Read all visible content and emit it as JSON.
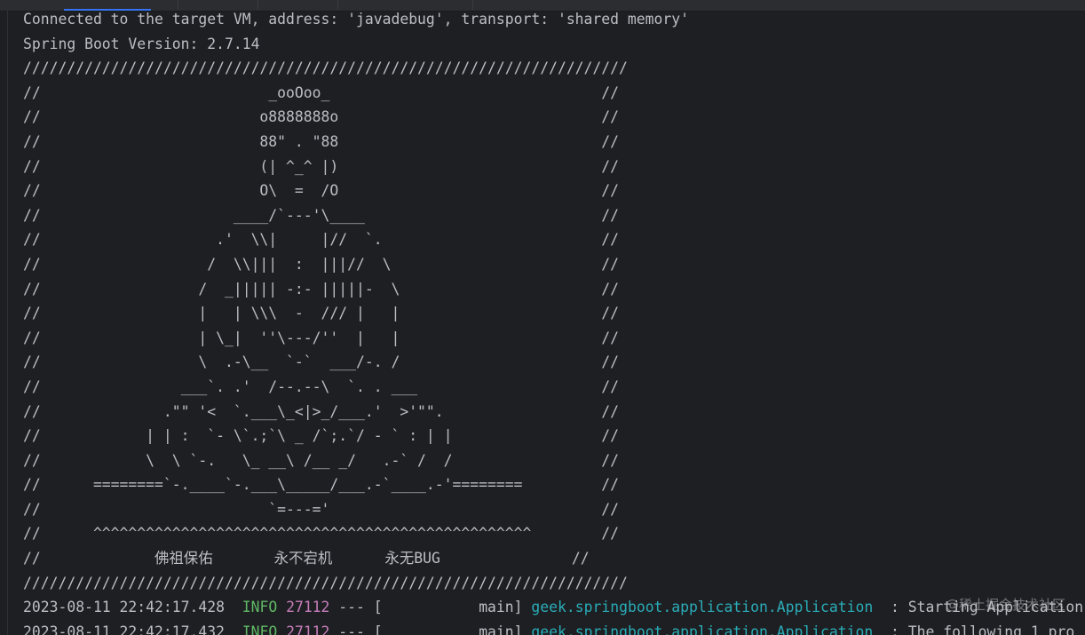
{
  "console": {
    "header_lines": [
      "Connected to the target VM, address: 'javadebug', transport: 'shared memory'",
      "Spring Boot Version: 2.7.14"
    ],
    "banner_lines": [
      "/////////////////////////////////////////////////////////////////////",
      "//                          _ooOoo_                               //",
      "//                         o8888888o                              //",
      "//                         88\" . \"88                              //",
      "//                         (| ^_^ |)                              //",
      "//                         O\\  =  /O                              //",
      "//                      ____/`---'\\____                           //",
      "//                    .'  \\\\|     |//  `.                         //",
      "//                   /  \\\\|||  :  |||//  \\                        //",
      "//                  /  _||||| -:- |||||-  \\                       //",
      "//                  |   | \\\\\\  -  /// |   |                       //",
      "//                  | \\_|  ''\\---/''  |   |                       //",
      "//                  \\  .-\\__  `-`  ___/-. /                       //",
      "//                ___`. .'  /--.--\\  `. . ___                     //",
      "//              .\"\" '<  `.___\\_<|>_/___.'  >'\"\".                  //",
      "//            | | :  `- \\`.;`\\ _ /`;.`/ - ` : | |                 //",
      "//            \\  \\ `-.   \\_ __\\ /__ _/   .-` /  /                 //",
      "//      ========`-.____`-.___\\_____/___.-`____.-'========         //",
      "//                          `=---='                               //",
      "//      ^^^^^^^^^^^^^^^^^^^^^^^^^^^^^^^^^^^^^^^^^^^^^^^^^^        //",
      "//             佛祖保佑       永不宕机      永无BUG               //",
      "/////////////////////////////////////////////////////////////////////"
    ],
    "log_lines": [
      {
        "timestamp": "2023-08-11 22:42:17.428",
        "level": "INFO",
        "pid": "27112",
        "separator": " --- [",
        "thread": "           main]",
        "logger": "geek.springboot.application.Application",
        "message": "  : Starting Application"
      },
      {
        "timestamp": "2023-08-11 22:42:17.432",
        "level": "INFO",
        "pid": "27112",
        "separator": " --- [",
        "thread": "           main]",
        "logger": "geek.springboot.application.Application",
        "message": "  : The following 1 pro"
      }
    ],
    "watermark": "@稀土掘金技术社区"
  },
  "colors": {
    "background": "#1e1f22",
    "text": "#bcbec4",
    "level_info": "#5fb865",
    "pid": "#c77dbb",
    "logger": "#2aacb8"
  }
}
